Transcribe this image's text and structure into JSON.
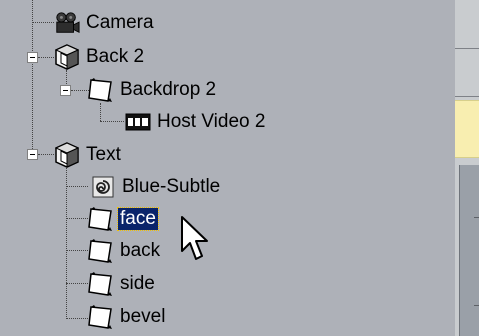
{
  "tree": {
    "items": [
      {
        "label": "Camera",
        "icon": "camera-icon"
      },
      {
        "label": "Back 2",
        "icon": "layer-cube-icon"
      },
      {
        "label": "Backdrop 2",
        "icon": "backdrop-icon"
      },
      {
        "label": "Host Video 2",
        "icon": "film-strip-icon"
      },
      {
        "label": "Text",
        "icon": "layer-cube-icon"
      },
      {
        "label": "Blue-Subtle",
        "icon": "swirl-material-icon"
      },
      {
        "label": "face",
        "icon": "backdrop-icon",
        "selected": true
      },
      {
        "label": "back",
        "icon": "backdrop-icon"
      },
      {
        "label": "side",
        "icon": "backdrop-icon"
      },
      {
        "label": "bevel",
        "icon": "backdrop-icon"
      }
    ]
  },
  "colors": {
    "selection_bg": "#0a246a",
    "selection_fg": "#ffffff",
    "panel_bg": "#aeb1b8",
    "highlight_yellow": "#f8eeb0"
  }
}
